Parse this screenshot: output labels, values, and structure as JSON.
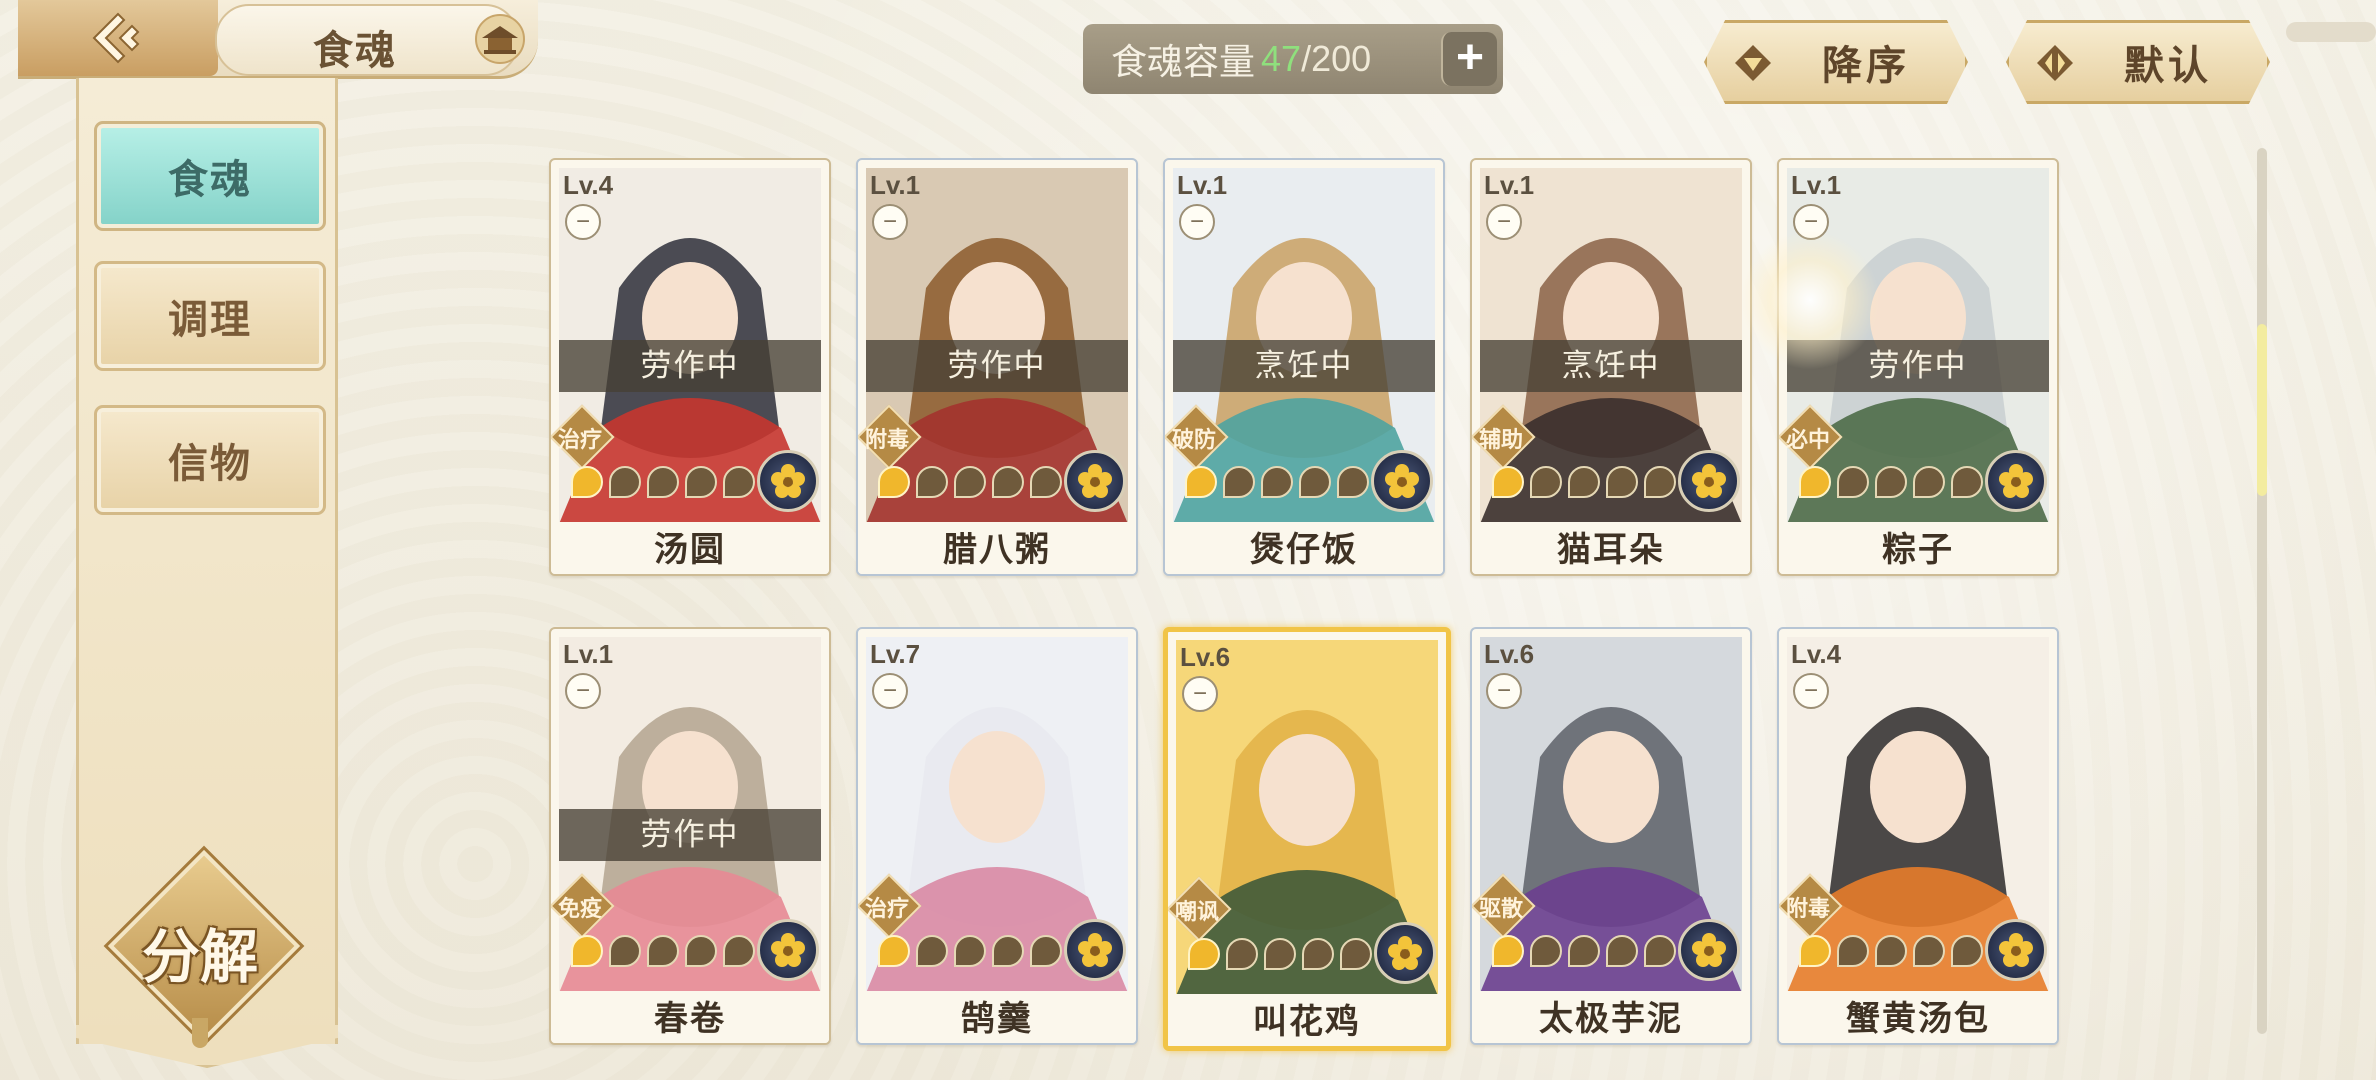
{
  "header": {
    "title": "食魂",
    "capacity_label": "食魂容量",
    "capacity_current": "47",
    "capacity_max": "/200",
    "sort_order_label": "降序",
    "sort_default_label": "默认"
  },
  "sidebar": {
    "tabs": [
      {
        "label": "食魂",
        "active": true
      },
      {
        "label": "调理",
        "active": false
      },
      {
        "label": "信物",
        "active": false
      }
    ],
    "decompose_label": "分解"
  },
  "colors": {
    "active_tab": "#85d3c9",
    "status_overlay": "#464034",
    "capacity_current": "#8fe07d",
    "gold_frame": "#f1c447"
  },
  "cards": [
    {
      "level": "Lv.4",
      "name": "汤圆",
      "role": "治疗",
      "status": "劳作中",
      "stars": 1,
      "frame": "normal",
      "art": [
        "#f1ece4",
        "#2e2f3a",
        "#c7362f"
      ]
    },
    {
      "level": "Lv.1",
      "name": "腊八粥",
      "role": "附毒",
      "status": "劳作中",
      "stars": 1,
      "frame": "blue",
      "art": [
        "#d9c9b3",
        "#8b5a2b",
        "#a3332e"
      ]
    },
    {
      "level": "Lv.1",
      "name": "煲仔饭",
      "role": "破防",
      "status": "烹饪中",
      "stars": 1,
      "frame": "blue",
      "art": [
        "#e9edf0",
        "#c9a063",
        "#4fa3a0"
      ]
    },
    {
      "level": "Lv.1",
      "name": "猫耳朵",
      "role": "辅助",
      "status": "烹饪中",
      "stars": 1,
      "frame": "normal",
      "art": [
        "#efe3d2",
        "#8a6246",
        "#3a2f2c"
      ]
    },
    {
      "level": "Lv.1",
      "name": "粽子",
      "role": "必中",
      "status": "劳作中",
      "stars": 1,
      "frame": "normal",
      "art": [
        "#e8ebe6",
        "#c8cfd0",
        "#4e6b48"
      ]
    },
    {
      "level": "Lv.1",
      "name": "春卷",
      "role": "免疫",
      "status": "劳作中",
      "stars": 1,
      "frame": "normal",
      "art": [
        "#f3ece2",
        "#b3a58f",
        "#e78a95"
      ]
    },
    {
      "level": "Lv.7",
      "name": "鹄羹",
      "role": "治疗",
      "status": "",
      "stars": 1,
      "frame": "blue",
      "art": [
        "#eef0f4",
        "#e8e9ee",
        "#d98aa4"
      ]
    },
    {
      "level": "Lv.6",
      "name": "叫花鸡",
      "role": "嘲讽",
      "status": "",
      "stars": 1,
      "frame": "gold",
      "art": [
        "#f6d779",
        "#e2b247",
        "#3f5a3a"
      ]
    },
    {
      "level": "Lv.6",
      "name": "太极芋泥",
      "role": "驱散",
      "status": "",
      "stars": 1,
      "frame": "blue",
      "art": [
        "#d5d9dd",
        "#5d6068",
        "#6b3f8f"
      ]
    },
    {
      "level": "Lv.4",
      "name": "蟹黄汤包",
      "role": "附毒",
      "status": "",
      "stars": 1,
      "frame": "blue",
      "art": [
        "#f5efe6",
        "#2d2a2a",
        "#e77c2a"
      ]
    }
  ]
}
